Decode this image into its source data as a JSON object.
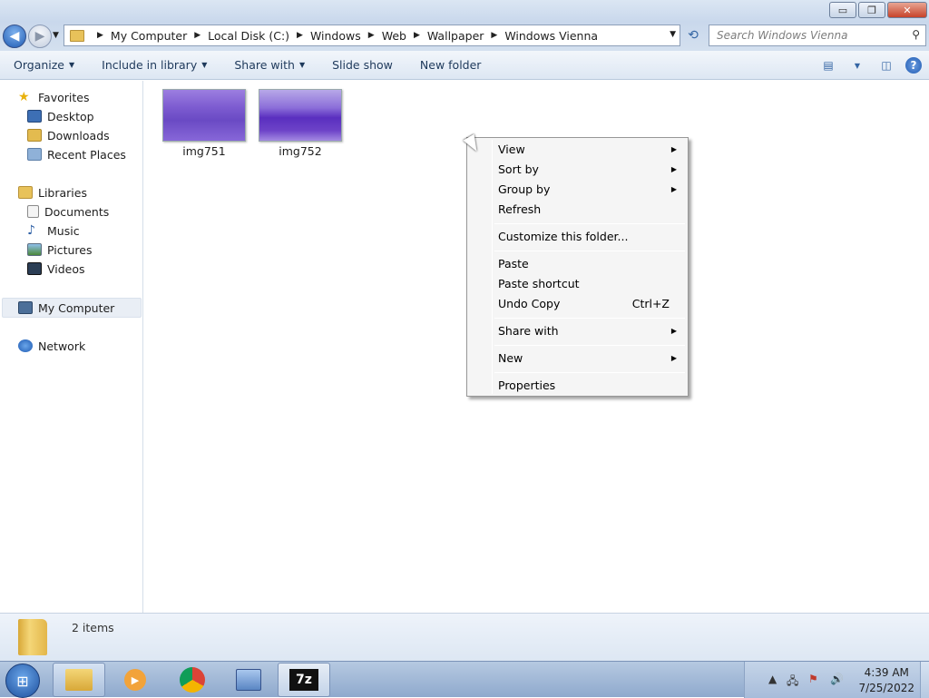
{
  "window": {
    "buttons": {
      "minimize": "▭",
      "maximize": "❐",
      "close": "✕"
    }
  },
  "address": {
    "breadcrumbs": [
      "My Computer",
      "Local Disk (C:)",
      "Windows",
      "Web",
      "Wallpaper",
      "Windows Vienna"
    ],
    "search_placeholder": "Search Windows Vienna"
  },
  "toolbar": {
    "organize": "Organize",
    "include_in_library": "Include in library",
    "share_with": "Share with",
    "slide_show": "Slide show",
    "new_folder": "New folder"
  },
  "nav": {
    "favorites": "Favorites",
    "desktop": "Desktop",
    "downloads": "Downloads",
    "recent_places": "Recent Places",
    "libraries": "Libraries",
    "documents": "Documents",
    "music": "Music",
    "pictures": "Pictures",
    "videos": "Videos",
    "my_computer": "My Computer",
    "network": "Network"
  },
  "files": [
    {
      "name": "img751"
    },
    {
      "name": "img752"
    }
  ],
  "status": {
    "count": "2 items"
  },
  "context_menu": {
    "view": "View",
    "sort_by": "Sort by",
    "group_by": "Group by",
    "refresh": "Refresh",
    "customize": "Customize this folder...",
    "paste": "Paste",
    "paste_shortcut": "Paste shortcut",
    "undo_copy": "Undo Copy",
    "undo_copy_shortcut": "Ctrl+Z",
    "share_with": "Share with",
    "new": "New",
    "properties": "Properties"
  },
  "taskbar": {
    "time": "4:39 AM",
    "date": "7/25/2022",
    "seven_zip": "7z"
  },
  "colors": {
    "accent": "#1f5bb3",
    "selection": "#e9eef5"
  }
}
